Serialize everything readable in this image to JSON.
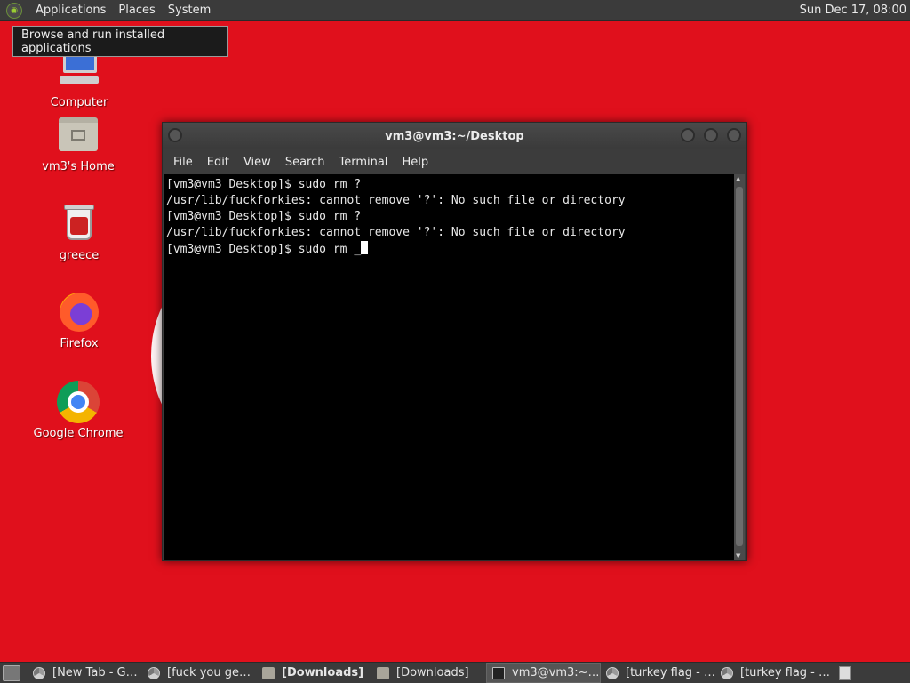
{
  "top_panel": {
    "menus": [
      "Applications",
      "Places",
      "System"
    ],
    "clock": "Sun Dec 17, 08:00",
    "tooltip": "Browse and run installed applications"
  },
  "desktop_icons": [
    {
      "label": "Computer",
      "icon": "computer-icon"
    },
    {
      "label": "vm3's Home",
      "icon": "home-folder-icon"
    },
    {
      "label": "greece",
      "icon": "trash-icon"
    },
    {
      "label": "Firefox",
      "icon": "firefox-icon"
    },
    {
      "label": "Google Chrome",
      "icon": "chrome-icon"
    }
  ],
  "terminal": {
    "title": "vm3@vm3:~/Desktop",
    "menu": [
      "File",
      "Edit",
      "View",
      "Search",
      "Terminal",
      "Help"
    ],
    "lines": [
      "[vm3@vm3 Desktop]$ sudo rm ?",
      "/usr/lib/fuckforkies: cannot remove '?': No such file or directory",
      "[vm3@vm3 Desktop]$ sudo rm ?",
      "/usr/lib/fuckforkies: cannot remove '?': No such file or directory",
      "[vm3@vm3 Desktop]$ sudo rm _"
    ]
  },
  "taskbar": {
    "tasks": [
      {
        "label": "[New Tab - G…",
        "icon": "chrome"
      },
      {
        "label": "[fuck you gee…",
        "icon": "chrome"
      },
      {
        "label": "[Downloads]",
        "icon": "folder",
        "bold": true
      },
      {
        "label": "[Downloads]",
        "icon": "folder"
      },
      {
        "label": "vm3@vm3:~/…",
        "icon": "term",
        "active": true
      },
      {
        "label": "[turkey flag - …",
        "icon": "chrome"
      },
      {
        "label": "[turkey flag - …",
        "icon": "chrome"
      }
    ]
  },
  "colors": {
    "wallpaper": "#e0101c",
    "panel": "#3b3b3b",
    "terminal_bg": "#000000"
  }
}
